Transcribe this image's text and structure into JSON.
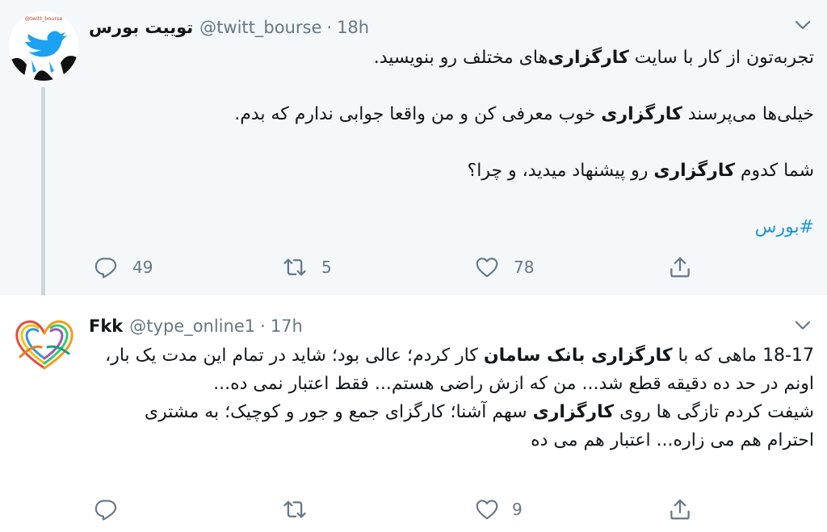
{
  "tweets": [
    {
      "display_name": "توییت بورس",
      "handle": "@twitt_bourse",
      "separator": "·",
      "time": "18h",
      "avatar_label": "@twitt_bourse",
      "paragraphs": [
        [
          "تجربه‌تون از کار با سایت ",
          "کارگزاری",
          "‌های مختلف رو بنویسید."
        ],
        [
          "خیلی‌ها می‌پرسند ",
          "کارگزاری",
          " خوب معرفی کن و من واقعا جوابی ندارم که بدم."
        ],
        [
          "شما کدوم ",
          "کارگزاری",
          " رو پیشنهاد میدید، و چرا؟"
        ]
      ],
      "hashtag": "#بورس",
      "actions": {
        "replies": "49",
        "retweets": "5",
        "likes": "78"
      }
    },
    {
      "display_name": "Fkk",
      "handle": "@type_online1",
      "separator": "·",
      "time": "17h",
      "paragraphs": [
        [
          "18-17 ماهی که با ",
          "کارگزاری بانک سامان",
          " کار کردم؛ عالی بود؛ شاید در تمام این مدت یک بار، اونم در حد ده دقیقه قطع شد... من که ازش راضی هستم... فقط اعتبار نمی ده..."
        ],
        [
          "شیفت کردم تازگی ها روی ",
          "کارگزاری",
          " سهم آشنا؛ کارگزای جمع و جور و کوچیک؛  به مشتری احترام هم می زاره... اعتبار هم می ده"
        ]
      ],
      "actions": {
        "replies": "",
        "retweets": "",
        "likes": "9"
      }
    }
  ],
  "icons": {
    "reply": "reply-icon",
    "retweet": "retweet-icon",
    "like": "heart-icon",
    "share": "share-icon",
    "caret": "chevron-down-icon"
  },
  "colors": {
    "hashtag": "#1b95e0",
    "muted": "#657786",
    "thread_line": "#ccd6dd",
    "first_tweet_bg": "#f5f8fa"
  }
}
